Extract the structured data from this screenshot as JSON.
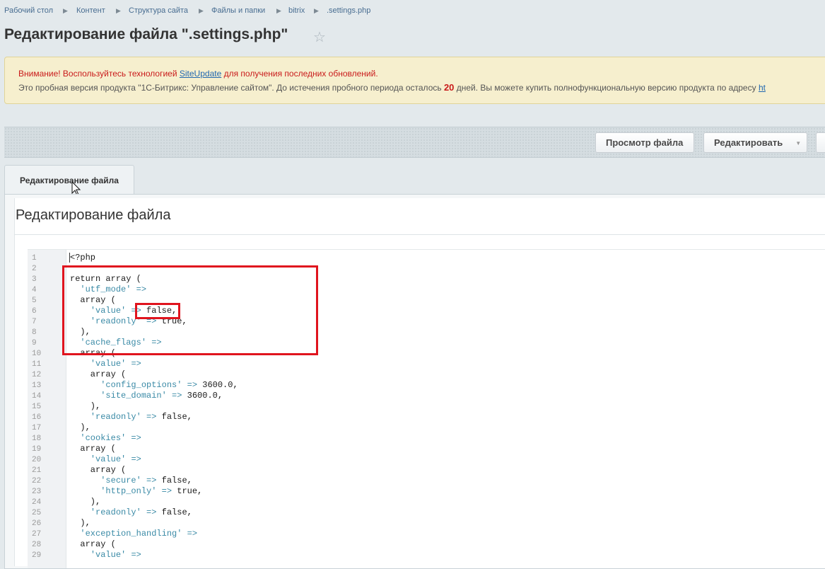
{
  "breadcrumb": [
    "Рабочий стол",
    "Контент",
    "Структура сайта",
    "Файлы и папки",
    "bitrix",
    ".settings.php"
  ],
  "page_title": "Редактирование файла \".settings.php\"",
  "notice": {
    "line1_prefix": "Внимание! Воспользуйтесь технологией ",
    "line1_link": "SiteUpdate",
    "line1_suffix": " для получения последних обновлений.",
    "line2_prefix": "Это пробная версия продукта \"1С-Битрикс: Управление сайтом\". До истечения пробного периода осталось ",
    "days": "20",
    "line2_suffix": " дней. Вы можете купить полнофункциональную версию продукта по адресу ",
    "line2_link": "ht"
  },
  "toolbar": {
    "view_file": "Просмотр файла",
    "edit": "Редактировать"
  },
  "tab_label": "Редактирование файла",
  "section_title": "Редактирование файла",
  "code_lines": [
    "<?php",
    "",
    "return array (",
    "  'utf_mode' =>",
    "  array (",
    "    'value' => false,",
    "    'readonly' => true,",
    "  ),",
    "  'cache_flags' =>",
    "  array (",
    "    'value' =>",
    "    array (",
    "      'config_options' => 3600.0,",
    "      'site_domain' => 3600.0,",
    "    ),",
    "    'readonly' => false,",
    "  ),",
    "  'cookies' =>",
    "  array (",
    "    'value' =>",
    "    array (",
    "      'secure' => false,",
    "      'http_only' => true,",
    "    ),",
    "    'readonly' => false,",
    "  ),",
    "  'exception_handling' =>",
    "  array (",
    "    'value' =>"
  ],
  "colors": {
    "highlight": "#e0141e",
    "string": "#3a8aa6",
    "warning_text": "#c91a1a",
    "link": "#2067b0"
  }
}
